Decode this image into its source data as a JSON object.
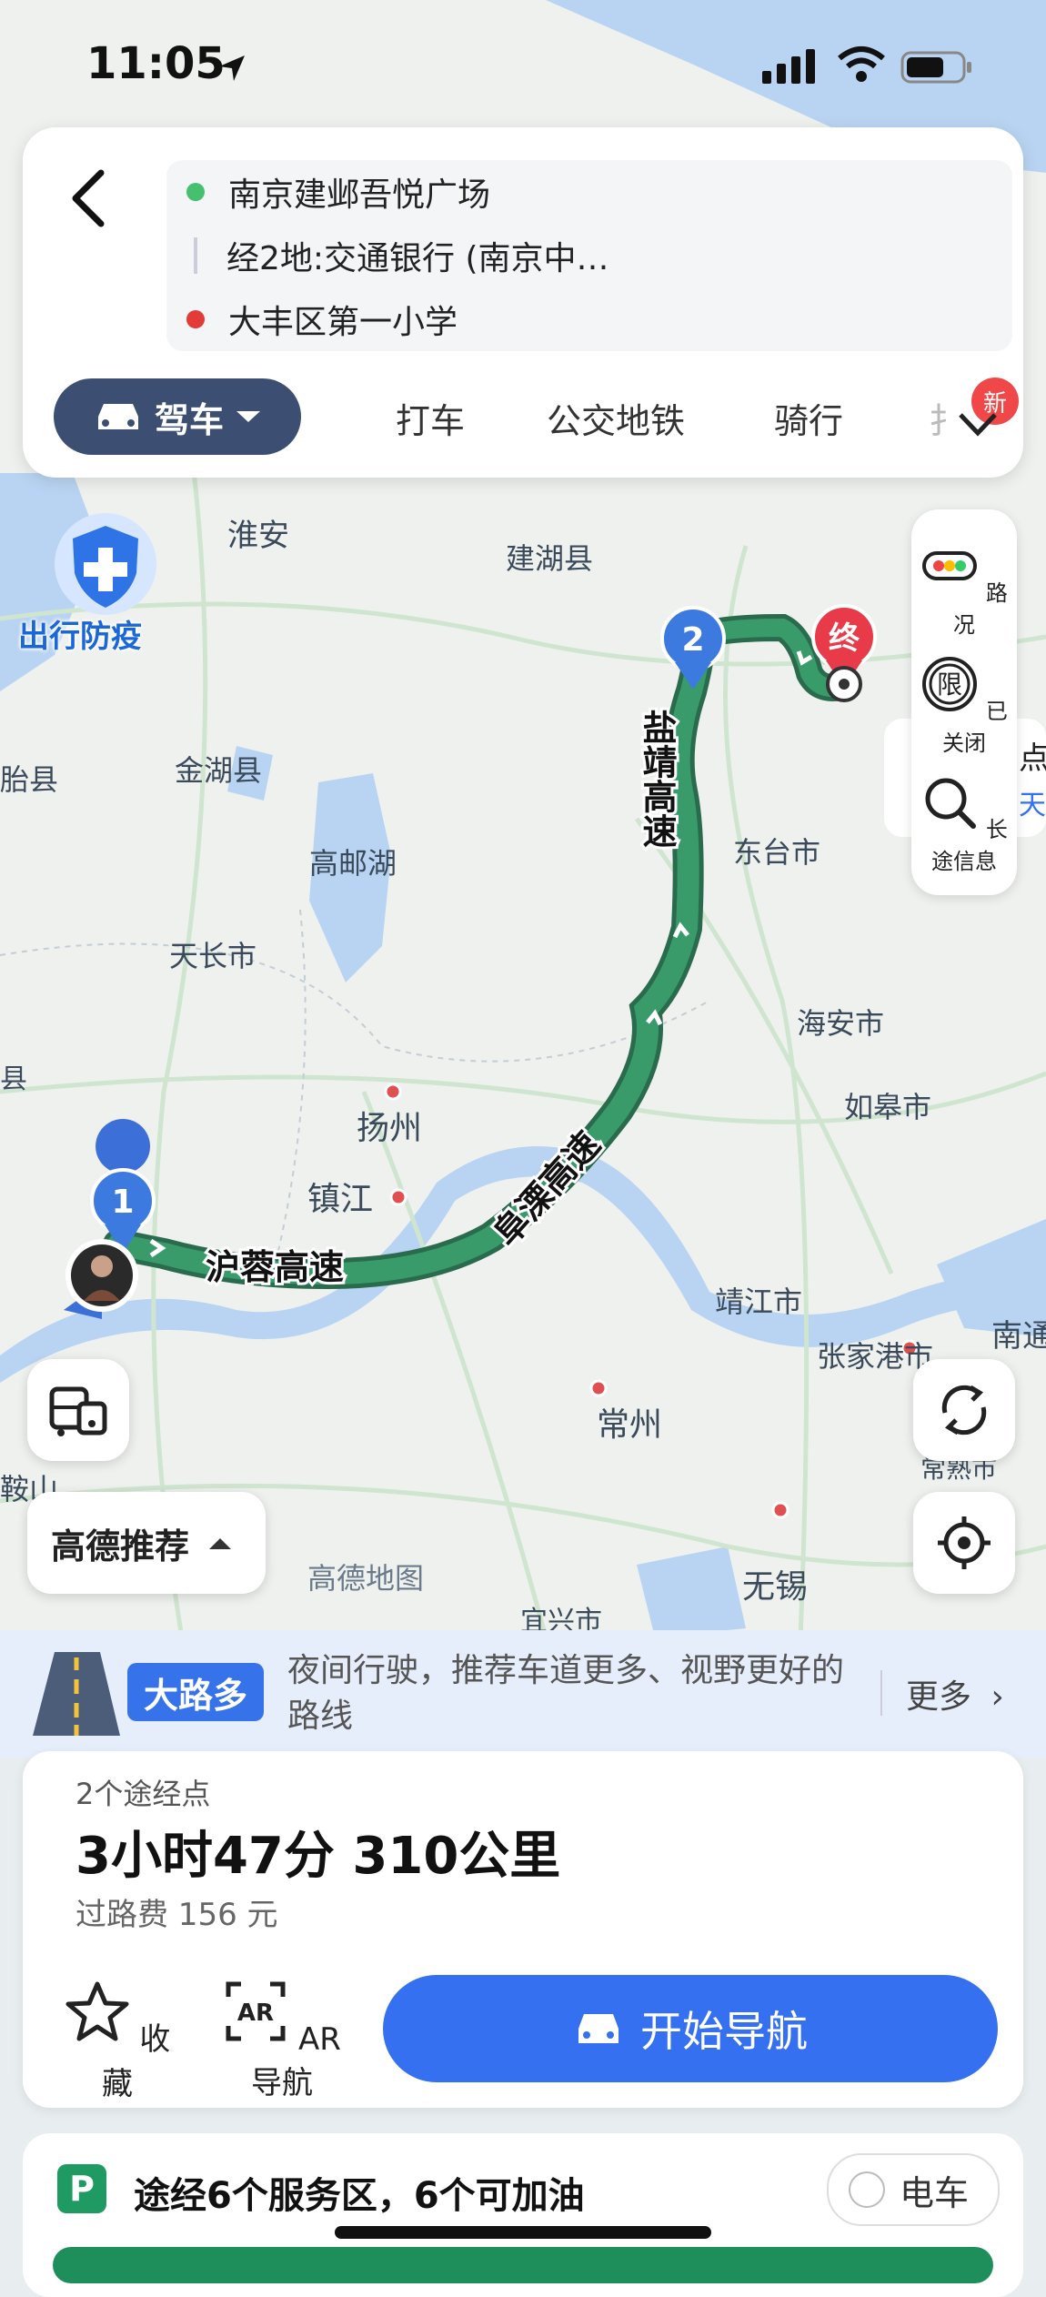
{
  "status": {
    "time": "11:05"
  },
  "search": {
    "origin": "南京建邺吾悦广场",
    "via": "经2地:交通银行 (南京中…",
    "destination": "大丰区第一小学"
  },
  "modes": {
    "active": "驾车",
    "tabs": [
      "打车",
      "公交地铁",
      "骑行",
      "扌"
    ],
    "new_badge": "新"
  },
  "map": {
    "labels": [
      {
        "text": "淮安"
      },
      {
        "text": "建湖县"
      },
      {
        "text": "金湖县"
      },
      {
        "text": "高邮湖"
      },
      {
        "text": "天长市"
      },
      {
        "text": "扬州"
      },
      {
        "text": "镇江"
      },
      {
        "text": "东台市"
      },
      {
        "text": "海安市"
      },
      {
        "text": "如皋市"
      },
      {
        "text": "靖江市"
      },
      {
        "text": "张家港市"
      },
      {
        "text": "常州"
      },
      {
        "text": "无锡"
      },
      {
        "text": "常熟市"
      },
      {
        "text": "南通"
      },
      {
        "text": "胎县"
      },
      {
        "text": "县"
      },
      {
        "text": "鞍山"
      },
      {
        "text": "高德地图"
      },
      {
        "text": "宜兴市"
      }
    ],
    "roads": {
      "r1": "沪蓉高速",
      "r2": "阜溧高速",
      "r3": "盐靖高速"
    },
    "markers": {
      "m1": "1",
      "m2": "2",
      "end": "终"
    },
    "pandemic_label": "出行防疫",
    "side_partial": {
      "a": "点",
      "b": "天"
    }
  },
  "tools": {
    "traffic": "路况",
    "restrict": "已关闭",
    "longtrip": "长途信息"
  },
  "recommend_label": "高德推荐",
  "tip": {
    "tag": "大路多",
    "text": "夜间行驶，推荐车道更多、视野更好的路线",
    "more": "更多"
  },
  "route": {
    "waypoints": "2个途经点",
    "summary": "3小时47分  310公里",
    "toll": "过路费 156 元",
    "fav_label": "收藏",
    "ar_label": "AR导航",
    "start_label": "开始导航"
  },
  "service": {
    "text": "途经6个服务区，6个可加油",
    "ev_label": "电车",
    "icon_letter": "P"
  },
  "colors": {
    "primary": "#3470f0",
    "route": "#2e8b57",
    "dark_tab": "#3c4f73"
  },
  "icons": [
    "location-arrow-icon",
    "signal-icon",
    "wifi-icon",
    "battery-icon",
    "back-icon",
    "plus-icon",
    "swap-icon",
    "mic-icon",
    "car-icon",
    "chevron-down-icon",
    "traffic-icon",
    "restrict-icon",
    "search-icon",
    "transit-icon",
    "refresh-icon",
    "locate-icon",
    "star-icon",
    "ar-icon",
    "parking-icon"
  ]
}
